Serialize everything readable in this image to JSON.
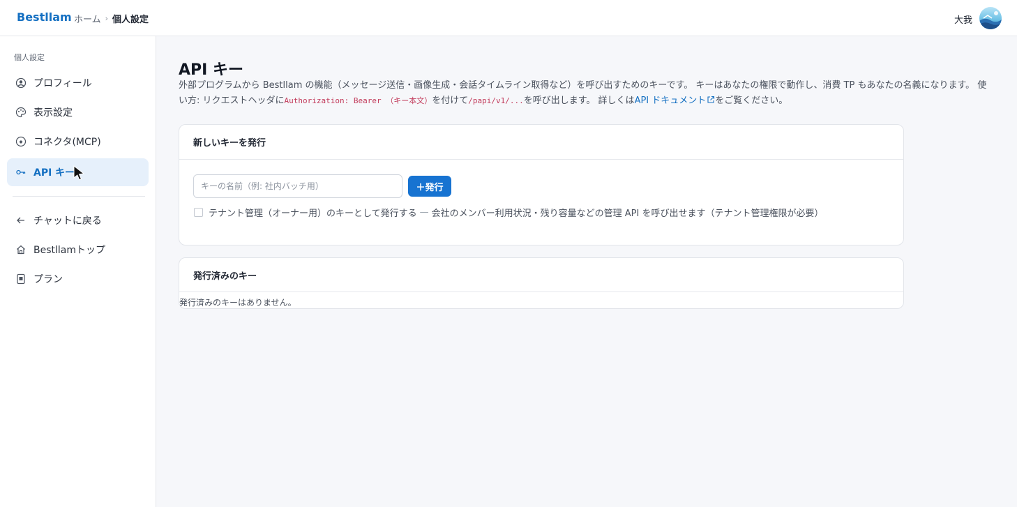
{
  "header": {
    "brand": "Bestllam",
    "breadcrumb_home": "ホーム",
    "breadcrumb_sep": "›",
    "breadcrumb_current": "個人設定",
    "user_name": "大我"
  },
  "sidebar": {
    "heading": "個人設定",
    "items": [
      {
        "label": "プロフィール",
        "icon": "user-circle-icon"
      },
      {
        "label": "表示設定",
        "icon": "palette-icon"
      },
      {
        "label": "コネクタ(MCP)",
        "icon": "plug-icon"
      },
      {
        "label": "API キー",
        "icon": "key-icon",
        "active": true
      }
    ],
    "links": [
      {
        "label": "チャットに戻る",
        "icon": "arrow-left-icon"
      },
      {
        "label": "Bestllamトップ",
        "icon": "home-icon"
      },
      {
        "label": "プラン",
        "icon": "plan-card-icon"
      }
    ]
  },
  "main": {
    "title": "API キー",
    "desc": {
      "part1": "外部プログラムから Bestllam の機能（メッセージ送信・画像生成・会話タイムライン取得など）を呼び出すためのキーです。 キーはあなたの権限で動作し、消費 TP もあなたの名義になります。 使い方: リクエストヘッダに",
      "code_header": "Authorization: Bearer （キー本文）",
      "part2": "を付けて",
      "code_path": "/papi/v1/...",
      "part3": "を呼び出します。 詳しくは",
      "doc_link": "API ドキュメント",
      "part4": "をご覧ください。"
    },
    "new_key": {
      "title": "新しいキーを発行",
      "input_placeholder": "キーの名前（例: 社内バッチ用）",
      "input_value": "",
      "issue_button": "＋発行",
      "tenant_label": "テナント管理（オーナー用）のキーとして発行する",
      "tenant_dash": "—",
      "tenant_note": "会社のメンバー利用状況・残り容量などの管理 API を呼び出せます（テナント管理権限が必要）",
      "tenant_checked": false
    },
    "issued": {
      "title": "発行済みのキー",
      "empty": "発行済みのキーはありません。"
    }
  },
  "colors": {
    "accent": "#1773d1",
    "brand": "#1570c2",
    "code": "#c23b5b",
    "active_bg": "#e6f0fb"
  }
}
